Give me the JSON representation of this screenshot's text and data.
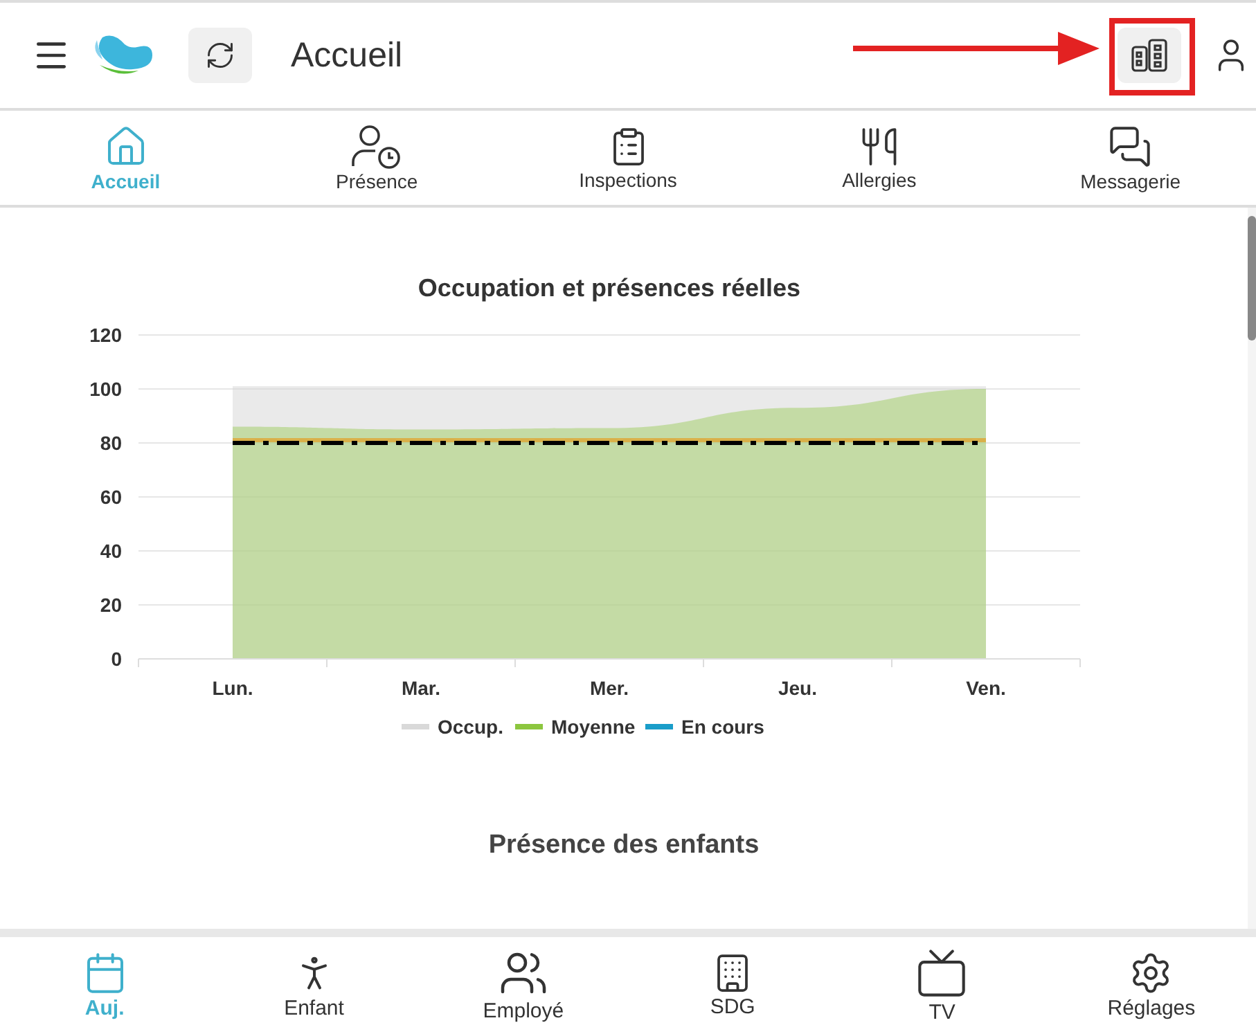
{
  "header": {
    "title": "Accueil",
    "buildings_button": {
      "highlighted": true
    }
  },
  "tabs": [
    {
      "label": "Accueil",
      "selected": true
    },
    {
      "label": "Présence",
      "selected": false
    },
    {
      "label": "Inspections",
      "selected": false
    },
    {
      "label": "Allergies",
      "selected": false
    },
    {
      "label": "Messagerie",
      "selected": false
    }
  ],
  "content": {
    "chart_data": {
      "type": "area",
      "title": "Occupation et présences réelles",
      "categories": [
        "Lun.",
        "Mar.",
        "Mer.",
        "Jeu.",
        "Ven."
      ],
      "ylim": [
        0,
        120
      ],
      "yticks": [
        0,
        20,
        40,
        60,
        80,
        100,
        120
      ],
      "series": [
        {
          "name": "Occup.",
          "color": "#d9d9d9",
          "values": [
            101,
            101,
            101,
            101,
            101
          ]
        },
        {
          "name": "Moyenne",
          "color": "#8cc63f",
          "values": [
            86,
            85,
            85.5,
            93,
            100
          ]
        },
        {
          "name": "En cours",
          "color": "#1a9dc9",
          "values": [
            null,
            null,
            null,
            null,
            null
          ]
        }
      ],
      "grid": true,
      "legend": true,
      "ref_lines": [
        {
          "axis": "y",
          "value": 81,
          "color": "#d9b04a"
        },
        {
          "axis": "y",
          "value": 80,
          "color": "#000000"
        }
      ]
    },
    "section_title": "Présence des enfants"
  },
  "bottom_nav": [
    {
      "label": "Auj.",
      "selected": true
    },
    {
      "label": "Enfant",
      "selected": false
    },
    {
      "label": "Employé",
      "selected": false
    },
    {
      "label": "SDG",
      "selected": false
    },
    {
      "label": "TV",
      "selected": false
    },
    {
      "label": "Réglages",
      "selected": false
    }
  ]
}
